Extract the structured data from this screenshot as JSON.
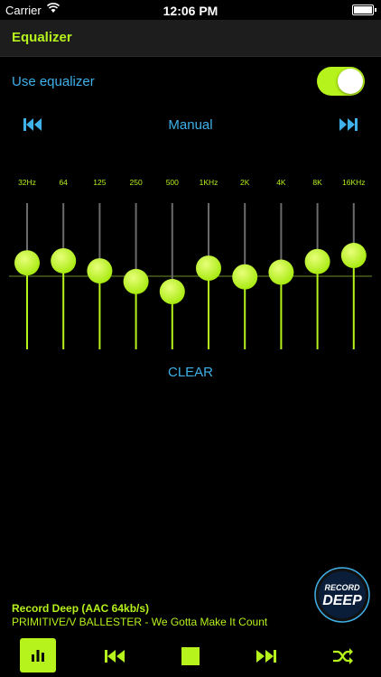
{
  "status_bar": {
    "carrier": "Carrier",
    "time": "12:06 PM"
  },
  "nav": {
    "title": "Equalizer"
  },
  "use_equalizer": {
    "label": "Use equalizer",
    "enabled": true
  },
  "preset": {
    "name": "Manual",
    "prev_icon": "skip-back-icon",
    "next_icon": "skip-forward-icon"
  },
  "eq": {
    "bands": [
      "32Hz",
      "64",
      "125",
      "250",
      "500",
      "1KHz",
      "2K",
      "4K",
      "8K",
      "16KHz"
    ],
    "levels": [
      0.2,
      0.23,
      0.08,
      -0.08,
      -0.23,
      0.12,
      -0.01,
      0.06,
      0.22,
      0.31
    ]
  },
  "clear_label": "CLEAR",
  "station_logo": {
    "top_text": "RECORD",
    "main_text": "DEEP"
  },
  "now_playing": {
    "station": "Record Deep (AAC 64kb/s)",
    "track": "PRIMITIVE/V BALLESTER - We Gotta Make It Count"
  },
  "controls": [
    "equalizer-icon",
    "previous-icon",
    "stop-icon",
    "next-icon",
    "shuffle-icon"
  ],
  "colors": {
    "accent": "#b6f21c",
    "link": "#3fb0e8",
    "background": "#000000"
  }
}
